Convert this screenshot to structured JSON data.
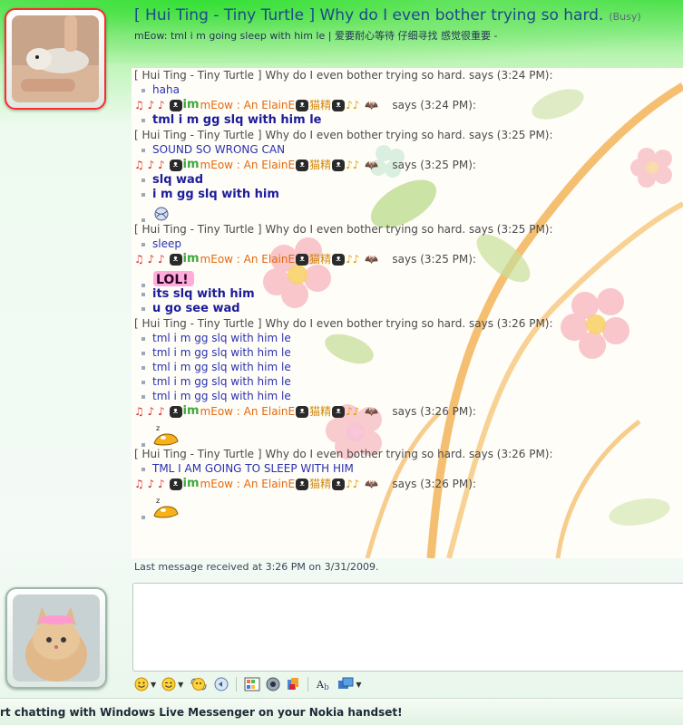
{
  "header": {
    "title": "[ Hui Ting - Tiny Turtle ] Why do I even bother trying so hard.",
    "status": "(Busy)",
    "subtitle": "mEow: tml i m going sleep with him le  |   爱要耐心等待 仔细寻找 感觉很重要 -"
  },
  "contact_label": "[ Hui Ting - Tiny Turtle ] Why do I even bother trying so hard. says",
  "self": {
    "nick_left": "mEow : An ElainE",
    "nick_right": "猫精",
    "says": "says"
  },
  "conversation": [
    {
      "from": "contact",
      "time": "(3:24 PM):",
      "lines": [
        {
          "text": "haha",
          "style": "blue"
        }
      ]
    },
    {
      "from": "self",
      "time": "(3:24 PM):",
      "lines": [
        {
          "text": "tml i m gg slq with him le",
          "style": "bold"
        }
      ]
    },
    {
      "from": "contact",
      "time": "(3:25 PM):",
      "lines": [
        {
          "text": "SOUND SO WRONG CAN",
          "style": "blue"
        }
      ]
    },
    {
      "from": "self",
      "time": "(3:25 PM):",
      "lines": [
        {
          "text": "slq wad",
          "style": "bold"
        },
        {
          "text": "i m gg slq with him",
          "style": "bold"
        },
        {
          "emoticon": "yarn-emoticon"
        }
      ]
    },
    {
      "from": "contact",
      "time": "(3:25 PM):",
      "lines": [
        {
          "text": "sleep",
          "style": "blue"
        }
      ]
    },
    {
      "from": "self",
      "time": "(3:25 PM):",
      "lines": [
        {
          "emoticon": "lol-emoticon"
        },
        {
          "text": "its slq with him",
          "style": "bold"
        },
        {
          "text": "u go see wad",
          "style": "bold"
        }
      ]
    },
    {
      "from": "contact",
      "time": "(3:26 PM):",
      "lines": [
        {
          "text": "tml i m gg slq with him le",
          "style": "blue"
        },
        {
          "text": "tml i m gg slq with him le",
          "style": "blue"
        },
        {
          "text": "tml i m gg slq with him le",
          "style": "blue"
        },
        {
          "text": "tml i m gg slq with him le",
          "style": "blue"
        },
        {
          "text": "tml i m gg slq with him le",
          "style": "blue"
        }
      ]
    },
    {
      "from": "self",
      "time": "(3:26 PM):",
      "lines": [
        {
          "emoticon": "sleeping-emoticon"
        }
      ]
    },
    {
      "from": "contact",
      "time": "(3:26 PM):",
      "lines": [
        {
          "text": "TML I AM GOING TO SLEEP WITH HIM",
          "style": "blue"
        }
      ]
    },
    {
      "from": "self",
      "time": "(3:26 PM):",
      "lines": [
        {
          "emoticon": "sleeping-emoticon"
        }
      ]
    }
  ],
  "last_message": "Last message received at 3:26 PM on 3/31/2009.",
  "toolbar": {
    "items": [
      "emoticon-button",
      "wink-button",
      "voice-clip-button",
      "nudge-button",
      "background-button",
      "sound-button",
      "send-file-button",
      "font-button",
      "color-button"
    ]
  },
  "footer": {
    "text": "rt chatting with Windows Live Messenger on your Nokia handset!"
  },
  "colors": {
    "title": "#1c4a8a",
    "contact_msg": "#2a32b0",
    "self_msg": "#1c1c9a",
    "nick": "#e26a10",
    "status_border": "#ff2a2a"
  }
}
